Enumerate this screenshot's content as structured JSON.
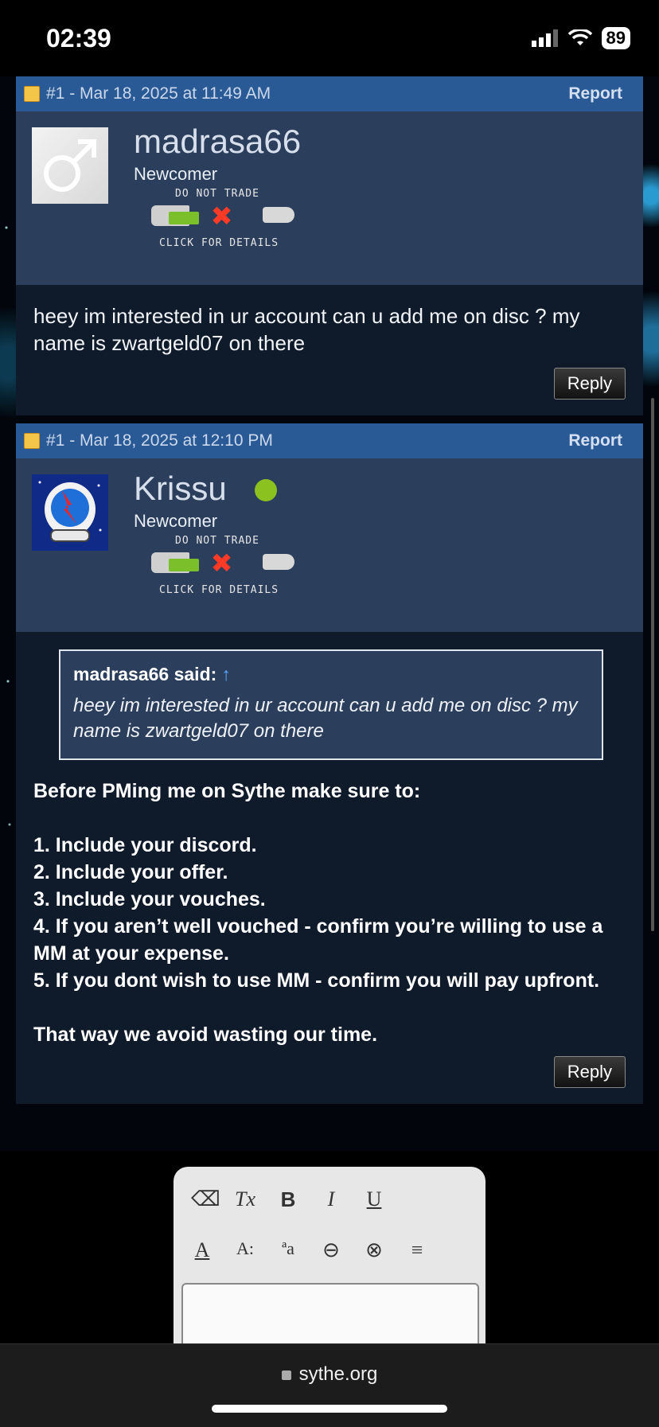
{
  "status_bar": {
    "time": "02:39",
    "battery": "89"
  },
  "posts": [
    {
      "number_date": "#1 - Mar 18, 2025 at 11:49 AM",
      "report": "Report",
      "username": "madrasa66",
      "rank": "Newcomer",
      "badge_top": "DO NOT TRADE",
      "badge_bottom": "CLICK FOR DETAILS",
      "message": "heey im interested in ur account can u add me on disc ? my name is zwartgeld07 on there",
      "reply": "Reply"
    },
    {
      "number_date": "#1 - Mar 18, 2025 at 12:10 PM",
      "report": "Report",
      "username": "Krissu",
      "rank": "Newcomer",
      "badge_top": "DO NOT TRADE",
      "badge_bottom": "CLICK FOR DETAILS",
      "quote_author": "madrasa66 said:",
      "quote_arrow": "↑",
      "quote_text": "heey im interested in ur account can u add me on disc ? my name is zwartgeld07 on there",
      "rules_intro": "Before PMing me on Sythe make sure to:",
      "rules": [
        "1. Include your discord.",
        "2. Include your offer.",
        "3. Include your vouches.",
        "4. If you aren’t well vouched - confirm you’re willing to use a MM at your expense.",
        "5. If you dont wish to use MM - confirm you will pay upfront."
      ],
      "rules_outro": "That way we avoid wasting our time.",
      "reply": "Reply"
    }
  ],
  "editor": {
    "row1": [
      "⌫",
      "Tx",
      "B",
      "I",
      "U"
    ],
    "row2": [
      "A",
      "A:",
      "ªa",
      "⊖",
      "⊗",
      "≡"
    ]
  },
  "browser": {
    "url": "sythe.org"
  }
}
